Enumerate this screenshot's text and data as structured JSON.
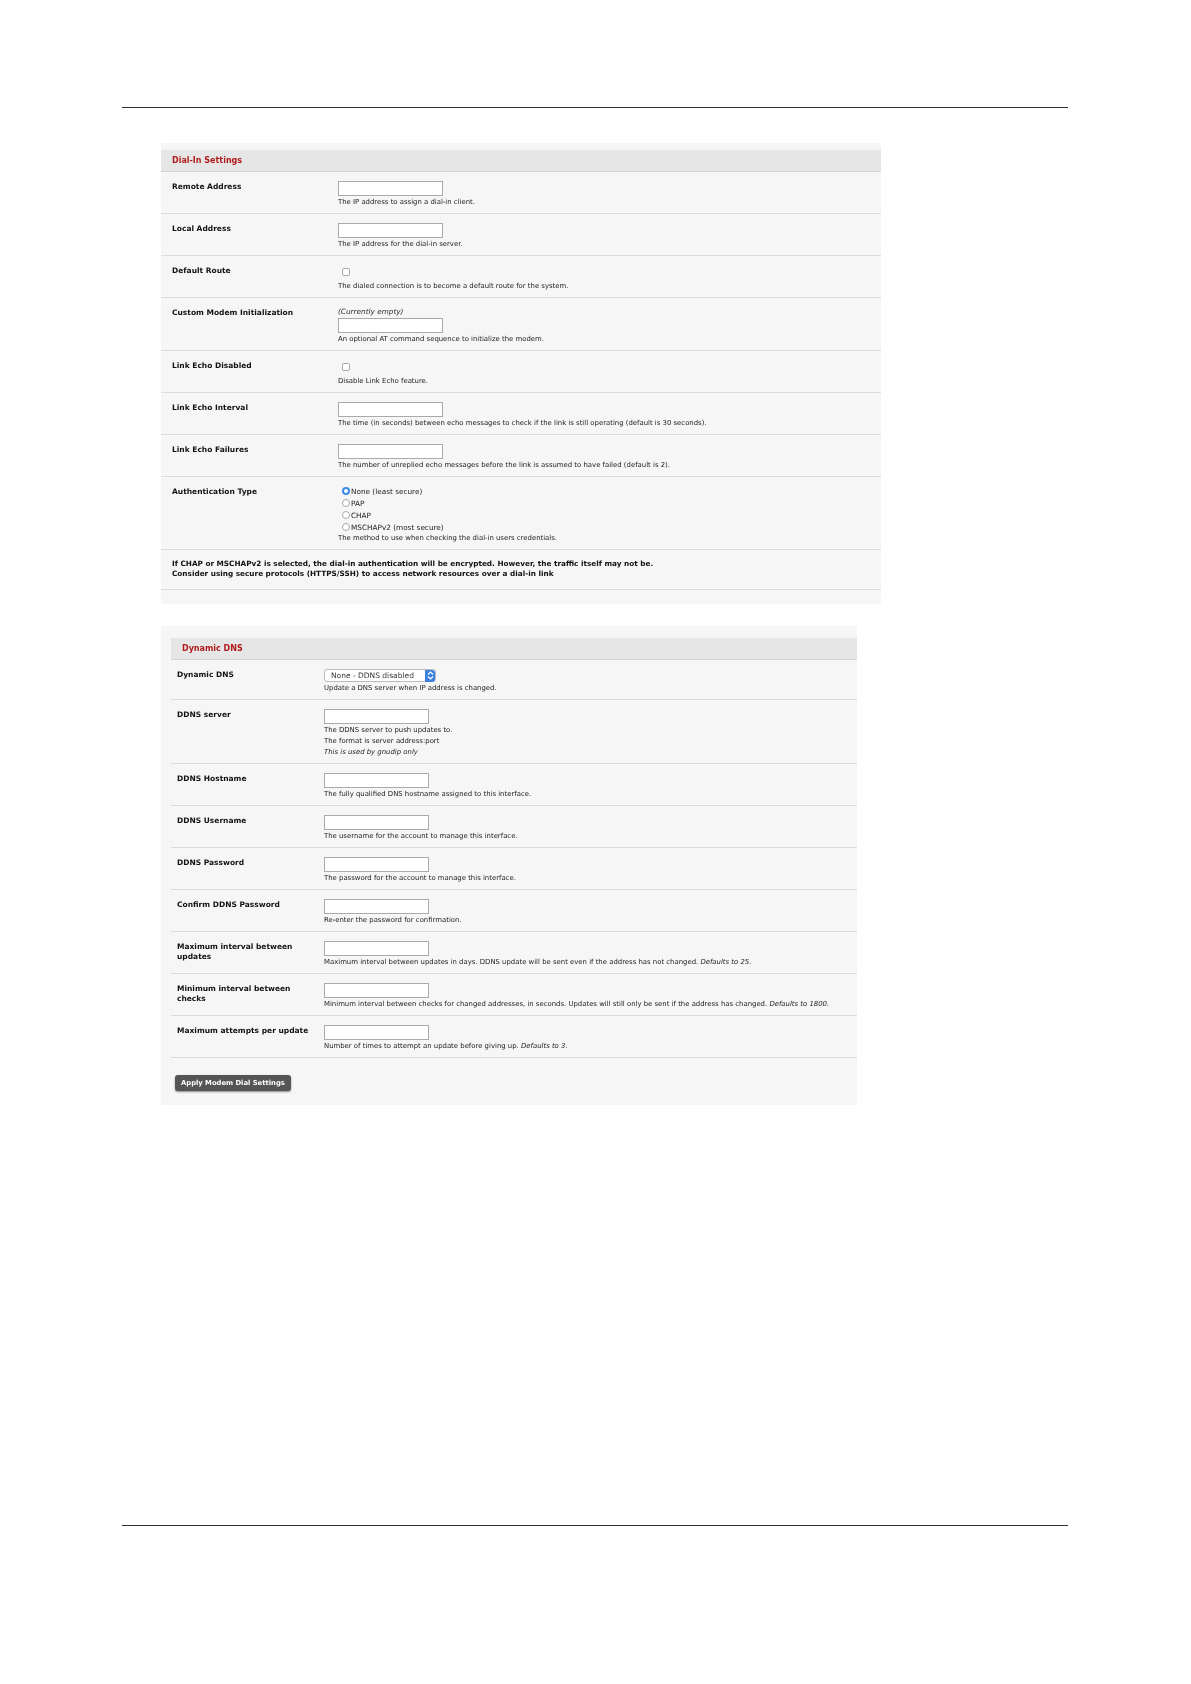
{
  "sections": [
    {
      "title": "Dial-In Settings",
      "rows": [
        {
          "kind": "text",
          "label": "Remote Address",
          "help": [
            "The IP address to assign a dial-in client."
          ]
        },
        {
          "kind": "text",
          "label": "Local Address",
          "help": [
            "The IP address for the dial-in server."
          ]
        },
        {
          "kind": "checkbox",
          "label": "Default Route",
          "checked": false,
          "help": [
            "The dialed connection is to become a default route for the system."
          ]
        },
        {
          "kind": "text",
          "label": "Custom Modem Initialization",
          "status": "(Currently empty)",
          "help": [
            "An optional AT command sequence to initialize the modem."
          ]
        },
        {
          "kind": "checkbox",
          "label": "Link Echo Disabled",
          "checked": false,
          "help": [
            "Disable Link Echo feature."
          ]
        },
        {
          "kind": "text",
          "label": "Link Echo Interval",
          "help": [
            "The time (in seconds) between echo messages to check if the link is still operating (default is 30 seconds)."
          ]
        },
        {
          "kind": "text",
          "label": "Link Echo Failures",
          "help": [
            "The number of unreplied echo messages before the link is assumed to have failed (default is 2)."
          ]
        },
        {
          "kind": "radio",
          "label": "Authentication Type",
          "options": [
            {
              "label": "None (least secure)",
              "selected": true
            },
            {
              "label": "PAP",
              "selected": false
            },
            {
              "label": "CHAP",
              "selected": false
            },
            {
              "label": "MSCHAPv2 (most secure)",
              "selected": false
            }
          ],
          "help": [
            "The method to use when checking the dial-in users credentials."
          ]
        },
        {
          "kind": "note",
          "lines": [
            "If CHAP or MSCHAPv2 is selected, the dial-in authentication will be encrypted. However, the traffic itself may not be.",
            "Consider using secure protocols (HTTPS/SSH) to access network resources over a dial-in link"
          ]
        }
      ]
    },
    {
      "title": "Dynamic DNS",
      "rows": [
        {
          "kind": "select",
          "label": "Dynamic DNS",
          "value": "None - DDNS disabled",
          "help": [
            "Update a DNS server when IP address is changed."
          ]
        },
        {
          "kind": "text",
          "label": "DDNS server",
          "help": [
            "The DDNS server to push updates to.",
            "The format is server address:port"
          ],
          "help_note": "This is used by gnudip only"
        },
        {
          "kind": "text",
          "label": "DDNS Hostname",
          "help": [
            "The fully qualified DNS hostname assigned to this interface."
          ]
        },
        {
          "kind": "text",
          "label": "DDNS Username",
          "help": [
            "The username for the account to manage this interface."
          ]
        },
        {
          "kind": "text",
          "label": "DDNS Password",
          "help": [
            "The password for the account to manage this interface."
          ]
        },
        {
          "kind": "text",
          "label": "Confirm DDNS Password",
          "help": [
            "Re-enter the password for confirmation."
          ]
        },
        {
          "kind": "text",
          "label": "Maximum interval between updates",
          "help": [
            "Maximum interval between updates in days. DDNS update will be sent even if the address has not changed. *Defaults to 25.*"
          ]
        },
        {
          "kind": "text",
          "label": "Minimum interval between checks",
          "help": [
            "Minimum interval between checks for changed addresses, in seconds. Updates will still only be sent if the address has changed. *Defaults to 1800.*"
          ]
        },
        {
          "kind": "text",
          "label": "Maximum attempts per update",
          "help": [
            "Number of times to attempt an update before giving up. *Defaults to 3.*"
          ]
        }
      ],
      "button": "Apply Modem Dial Settings"
    }
  ]
}
